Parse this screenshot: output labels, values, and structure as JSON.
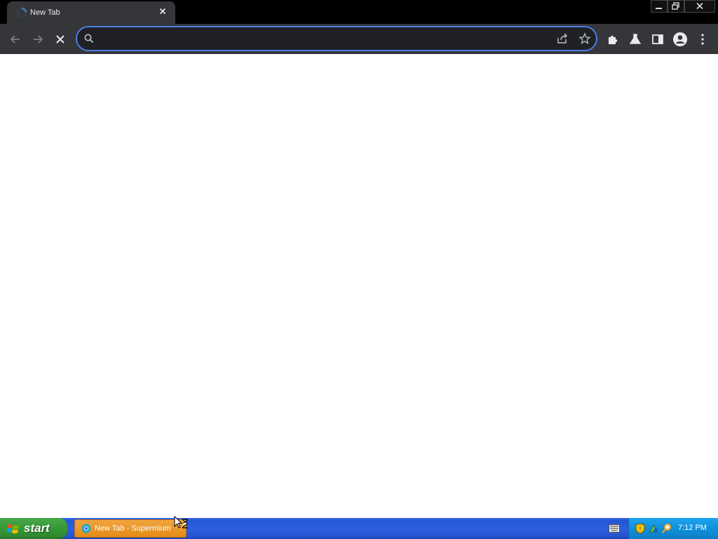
{
  "browser": {
    "tab": {
      "title": "New Tab",
      "close_icon": "close-icon",
      "favicon": "loading-spinner-icon"
    },
    "window_controls": {
      "minimize": "minimize-icon",
      "restore": "restore-icon",
      "close": "close-icon"
    },
    "toolbar": {
      "back": "arrow-left-icon",
      "forward": "arrow-right-icon",
      "stop": "close-icon",
      "extensions": "puzzle-icon",
      "labs": "flask-icon",
      "side_panel": "side-panel-icon",
      "profile": "profile-icon",
      "menu": "more-vertical-icon"
    },
    "omnibox": {
      "value": "",
      "search_icon": "search-icon",
      "share_icon": "share-icon",
      "bookmark_icon": "star-icon"
    },
    "accent_color": "#4a7ee8"
  },
  "taskbar": {
    "start_label": "start",
    "active_window": "New Tab - Supermium",
    "clock": "7:12 PM",
    "colors": {
      "taskbar": "#2456d6",
      "start": "#3a9b3a",
      "active_task": "#e48b15",
      "tray": "#1090db"
    }
  }
}
